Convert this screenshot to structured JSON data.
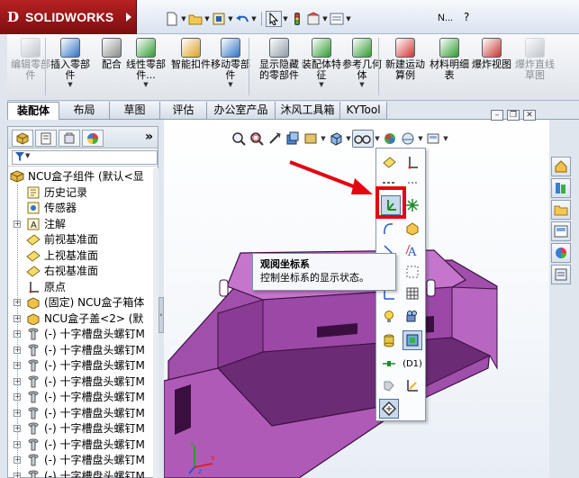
{
  "app": {
    "brand": "SOLIDWORKS",
    "brand_color": "#a3181b",
    "title_short": "N...",
    "title_help": "?"
  },
  "quick_access": [
    "new-document-icon",
    "open-folder-icon",
    "print-icon",
    "undo-icon",
    "select-pointer-icon",
    "traffic-light-icon",
    "options-icon",
    "file-properties-icon"
  ],
  "ribbon": {
    "items": [
      {
        "label": "编辑零部件",
        "icon": "edit-component-icon",
        "disabled": true,
        "arrow": false
      },
      {
        "label": "插入零部件",
        "icon": "insert-component-icon",
        "disabled": false,
        "arrow": true
      },
      {
        "label": "配合",
        "icon": "mate-icon",
        "disabled": false,
        "arrow": false
      },
      {
        "label": "线性零部件...",
        "icon": "linear-pattern-icon",
        "disabled": false,
        "arrow": true
      },
      {
        "label": "智能扣件",
        "icon": "smart-fasteners-icon",
        "disabled": false,
        "arrow": false
      },
      {
        "label": "移动零部件",
        "icon": "move-component-icon",
        "disabled": false,
        "arrow": true
      },
      {
        "label": "显示隐藏的零部件",
        "icon": "show-hidden-icon",
        "disabled": false,
        "arrow": false
      },
      {
        "label": "装配体特征",
        "icon": "assembly-features-icon",
        "disabled": false,
        "arrow": true
      },
      {
        "label": "参考几何体",
        "icon": "reference-geometry-icon",
        "disabled": false,
        "arrow": true
      },
      {
        "label": "新建运动算例",
        "icon": "new-motion-study-icon",
        "disabled": false,
        "arrow": false
      },
      {
        "label": "材料明细表",
        "icon": "bill-of-materials-icon",
        "disabled": false,
        "arrow": false
      },
      {
        "label": "爆炸视图",
        "icon": "exploded-view-icon",
        "disabled": false,
        "arrow": false
      },
      {
        "label": "爆炸直线草图",
        "icon": "explode-line-sketch-icon",
        "disabled": true,
        "arrow": false
      }
    ]
  },
  "tabs": [
    {
      "label": "装配体",
      "active": true
    },
    {
      "label": "布局",
      "active": false
    },
    {
      "label": "草图",
      "active": false
    },
    {
      "label": "评估",
      "active": false
    },
    {
      "label": "办公室产品",
      "active": false
    },
    {
      "label": "沐风工具箱",
      "active": false
    },
    {
      "label": "KYTool",
      "active": false
    }
  ],
  "panel": {
    "more": "»",
    "tree": [
      {
        "label": "NCU盒子组件  (默认<显",
        "icon": "assembly-icon",
        "level": 0,
        "expander": false
      },
      {
        "label": "历史记录",
        "icon": "history-icon",
        "level": 1,
        "expander": false
      },
      {
        "label": "传感器",
        "icon": "sensor-icon",
        "level": 1,
        "expander": false
      },
      {
        "label": "注解",
        "icon": "annotation-icon",
        "level": 1,
        "expander": true
      },
      {
        "label": "前视基准面",
        "icon": "plane-icon",
        "level": 1,
        "expander": false
      },
      {
        "label": "上视基准面",
        "icon": "plane-icon",
        "level": 1,
        "expander": false
      },
      {
        "label": "右视基准面",
        "icon": "plane-icon",
        "level": 1,
        "expander": false
      },
      {
        "label": "原点",
        "icon": "origin-icon",
        "level": 1,
        "expander": false
      },
      {
        "label": "(固定) NCU盒子箱体",
        "icon": "part-icon",
        "level": 1,
        "expander": true
      },
      {
        "label": "NCU盒子盖<2> (默",
        "icon": "part-icon",
        "level": 1,
        "expander": true
      },
      {
        "label": "(-) 十字槽盘头螺钉M",
        "icon": "screw-icon",
        "level": 1,
        "expander": true
      },
      {
        "label": "(-) 十字槽盘头螺钉M",
        "icon": "screw-icon",
        "level": 1,
        "expander": true
      },
      {
        "label": "(-) 十字槽盘头螺钉M",
        "icon": "screw-icon",
        "level": 1,
        "expander": true
      },
      {
        "label": "(-) 十字槽盘头螺钉M",
        "icon": "screw-icon",
        "level": 1,
        "expander": true
      },
      {
        "label": "(-) 十字槽盘头螺钉M",
        "icon": "screw-icon",
        "level": 1,
        "expander": true
      },
      {
        "label": "(-) 十字槽盘头螺钉M",
        "icon": "screw-icon",
        "level": 1,
        "expander": true
      },
      {
        "label": "(-) 十字槽盘头螺钉M",
        "icon": "screw-icon",
        "level": 1,
        "expander": true
      },
      {
        "label": "(-) 十字槽盘头螺钉M",
        "icon": "screw-icon",
        "level": 1,
        "expander": true
      },
      {
        "label": "(-) 十字槽盘头螺钉M",
        "icon": "screw-icon",
        "level": 1,
        "expander": true
      },
      {
        "label": "(-) 十字槽盘头螺钉M",
        "icon": "screw-icon",
        "level": 1,
        "expander": true
      },
      {
        "label": "(-) 十字槽盘头螺钉M",
        "icon": "screw-icon",
        "level": 1,
        "expander": true
      }
    ]
  },
  "flyout": {
    "d1_label": "(D1)",
    "highlight_color": "#e30613"
  },
  "tooltip": {
    "title": "观阅坐标系",
    "description": "控制坐标系的显示状态。"
  },
  "model": {
    "body_color": "#b05ab8",
    "dark_color": "#5b1e63"
  },
  "triad": {
    "x": "x",
    "y": "y",
    "z": "z"
  }
}
